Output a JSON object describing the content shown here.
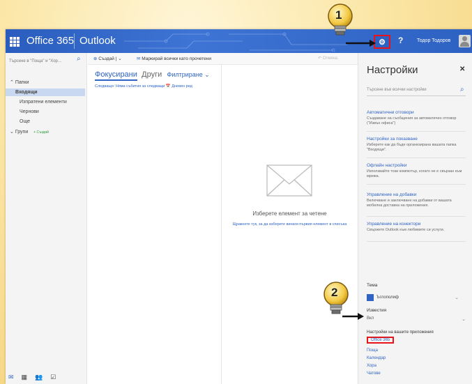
{
  "header": {
    "app_title": "Office 365",
    "module": "Outlook",
    "settings_button_icon": "gear-icon",
    "help_label": "?",
    "user_name": "Тодор Тодоров"
  },
  "leftnav": {
    "search_placeholder": "Търсене в \"Поща\" и \"Хор…",
    "folders_label": "Папки",
    "items": [
      {
        "label": "Входящи",
        "active": true
      },
      {
        "label": "Изпратени елементи"
      },
      {
        "label": "Чернови"
      },
      {
        "label": "Още"
      }
    ],
    "groups_label": "Групи",
    "groups_new": "+ Създай"
  },
  "toolbar": {
    "new_label": "Създай | ⌄",
    "mark_read_label": "Маркирай всички като прочетени",
    "undo_label": "↶ Отмяна"
  },
  "message_list": {
    "tab_focused": "Фокусирани",
    "tab_other": "Други",
    "filter_label": "Филтриране ⌄",
    "next_line": "Следващо: Няма събития за следващи    📅 Дневен ред"
  },
  "reading_pane": {
    "title": "Изберете елемент за четене",
    "hint": "Щракнете тук, за да изберете винаги първия елемент в списъка"
  },
  "settings": {
    "title": "Настройки",
    "close_label": "✕",
    "search_placeholder": "Търсене във всички настройки",
    "sections": [
      {
        "head": "Автоматични отговори",
        "desc": "Създаване на съобщения за автоматичен отговор (\"Извън офиса\")"
      },
      {
        "head": "Настройки за показване",
        "desc": "Изберете как да бъде организирана вашата папка \"Входящи\"."
      },
      {
        "head": "Офлайн настройки",
        "desc": "Използвайте този компютър, когато не е свързан към мрежа."
      },
      {
        "head": "Управление на добавки",
        "desc": "Включване и заключване на добавки от вашата мобилна доставка на приложения."
      },
      {
        "head": "Управление на конектори",
        "desc": "Свържете Outlook към любимите си услуги."
      }
    ],
    "theme_label": "Тема",
    "theme_value": "Ъглополиф",
    "notifications_label": "Известия",
    "notifications_value": "Вкл",
    "apps_label": "Настройки на вашите приложения",
    "apps": [
      "Office 365",
      "Поща",
      "Календар",
      "Хора",
      "Чатове"
    ]
  },
  "callouts": {
    "one": "1",
    "two": "2"
  }
}
